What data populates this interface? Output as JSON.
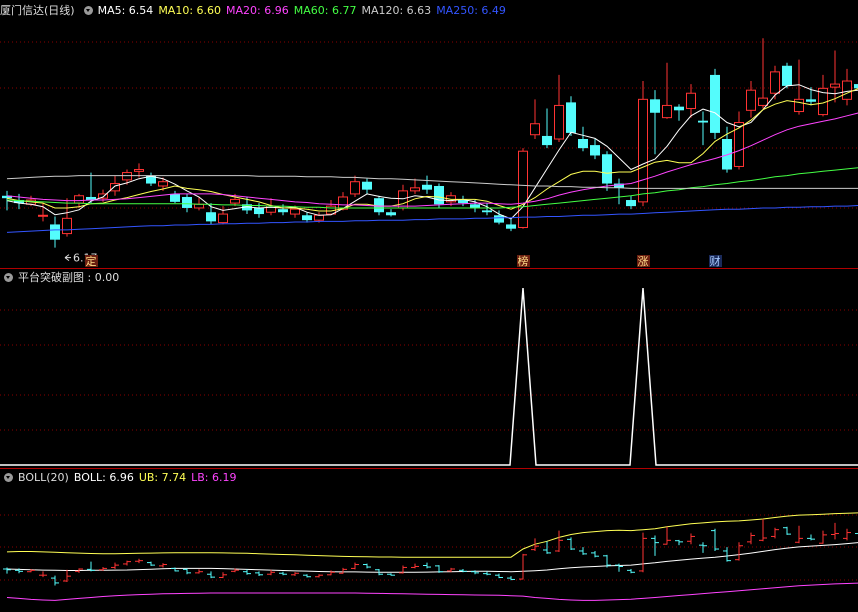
{
  "header1": {
    "stock": "厦门信达(日线)",
    "ma": [
      {
        "label": "MA5: 6.54",
        "color": "#ffffff"
      },
      {
        "label": "MA10: 6.60",
        "color": "#ffff55"
      },
      {
        "label": "MA20: 6.96",
        "color": "#ff44ff"
      },
      {
        "label": "MA60: 6.77",
        "color": "#44ff44"
      },
      {
        "label": "MA120: 6.63",
        "color": "#cccccc"
      },
      {
        "label": "MA250: 6.49",
        "color": "#3355ff"
      }
    ]
  },
  "header2": {
    "label": "平台突破副图 : 0.00"
  },
  "header3": {
    "name": "BOLL(20)",
    "items": [
      {
        "label": "BOLL: 6.96",
        "color": "#ffffff"
      },
      {
        "label": "UB: 7.74",
        "color": "#ffff55"
      },
      {
        "label": "LB: 6.19",
        "color": "#ff44ff"
      }
    ]
  },
  "annotations": {
    "low_label": "6.17"
  },
  "markers": [
    {
      "text": "定",
      "i": 7
    },
    {
      "text": "榜",
      "i": 43
    },
    {
      "text": "涨",
      "i": 53
    },
    {
      "text": "财",
      "i": 59
    }
  ],
  "colors": {
    "up": "#ff3333",
    "down": "#54fcfc",
    "grid": "#8a0000",
    "sep": "#b00000"
  },
  "chart_data": {
    "type": "candlestick",
    "bars": [
      [
        7.02,
        6.98,
        7.1,
        6.78
      ],
      [
        6.95,
        6.9,
        7.05,
        6.8
      ],
      [
        6.88,
        6.95,
        7.02,
        6.85
      ],
      [
        6.7,
        6.7,
        6.9,
        6.6
      ],
      [
        6.55,
        6.3,
        6.68,
        6.17
      ],
      [
        6.4,
        6.65,
        6.98,
        6.35
      ],
      [
        6.9,
        7.02,
        7.05,
        6.82
      ],
      [
        7.0,
        6.95,
        7.4,
        6.9
      ],
      [
        6.98,
        7.05,
        7.12,
        6.92
      ],
      [
        7.1,
        7.22,
        7.35,
        7.02
      ],
      [
        7.28,
        7.4,
        7.45,
        7.2
      ],
      [
        7.42,
        7.45,
        7.55,
        7.32
      ],
      [
        7.35,
        7.22,
        7.4,
        7.18
      ],
      [
        7.18,
        7.25,
        7.32,
        7.1
      ],
      [
        7.05,
        6.92,
        7.1,
        6.9
      ],
      [
        7.0,
        6.82,
        7.05,
        6.75
      ],
      [
        6.82,
        6.88,
        7.0,
        6.78
      ],
      [
        6.75,
        6.6,
        6.9,
        6.55
      ],
      [
        6.58,
        6.72,
        6.85,
        6.55
      ],
      [
        6.9,
        6.96,
        7.05,
        6.85
      ],
      [
        6.88,
        6.78,
        7.0,
        6.72
      ],
      [
        6.82,
        6.72,
        6.9,
        6.66
      ],
      [
        6.75,
        6.85,
        6.98,
        6.7
      ],
      [
        6.8,
        6.75,
        6.88,
        6.7
      ],
      [
        6.72,
        6.8,
        6.86,
        6.66
      ],
      [
        6.7,
        6.62,
        6.75,
        6.58
      ],
      [
        6.62,
        6.7,
        6.75,
        6.58
      ],
      [
        6.72,
        6.85,
        6.95,
        6.7
      ],
      [
        6.8,
        7.0,
        7.08,
        6.78
      ],
      [
        7.05,
        7.25,
        7.35,
        7.0
      ],
      [
        7.25,
        7.12,
        7.3,
        7.05
      ],
      [
        6.98,
        6.75,
        7.02,
        6.7
      ],
      [
        6.75,
        6.7,
        6.8,
        6.68
      ],
      [
        6.82,
        7.1,
        7.2,
        6.78
      ],
      [
        7.1,
        7.15,
        7.3,
        7.05
      ],
      [
        7.2,
        7.12,
        7.35,
        7.05
      ],
      [
        7.18,
        6.88,
        7.22,
        6.82
      ],
      [
        6.92,
        7.02,
        7.08,
        6.85
      ],
      [
        6.95,
        6.9,
        7.02,
        6.85
      ],
      [
        6.88,
        6.82,
        6.95,
        6.75
      ],
      [
        6.78,
        6.75,
        6.9,
        6.7
      ],
      [
        6.7,
        6.58,
        6.78,
        6.55
      ],
      [
        6.55,
        6.48,
        6.65,
        6.44
      ],
      [
        6.5,
        7.75,
        7.8,
        6.48
      ],
      [
        8.02,
        8.2,
        8.6,
        7.95
      ],
      [
        8.0,
        7.85,
        8.45,
        7.8
      ],
      [
        7.95,
        8.5,
        9.0,
        7.9
      ],
      [
        8.55,
        8.05,
        8.65,
        8.0
      ],
      [
        7.95,
        7.8,
        8.15,
        7.75
      ],
      [
        7.85,
        7.68,
        7.95,
        7.62
      ],
      [
        7.7,
        7.22,
        7.75,
        7.1
      ],
      [
        7.22,
        7.15,
        7.3,
        6.88
      ],
      [
        6.95,
        6.85,
        7.02,
        6.8
      ],
      [
        6.92,
        8.6,
        8.9,
        6.85
      ],
      [
        8.6,
        8.38,
        8.75,
        7.7
      ],
      [
        8.3,
        8.5,
        9.2,
        8.28
      ],
      [
        8.48,
        8.42,
        8.52,
        8.25
      ],
      [
        8.45,
        8.7,
        8.85,
        8.3
      ],
      [
        8.25,
        8.22,
        8.4,
        7.85
      ],
      [
        9.0,
        8.05,
        9.1,
        7.95
      ],
      [
        7.95,
        7.45,
        8.15,
        7.4
      ],
      [
        7.5,
        8.22,
        8.4,
        7.45
      ],
      [
        8.42,
        8.75,
        8.9,
        8.3
      ],
      [
        8.5,
        8.62,
        9.6,
        8.45
      ],
      [
        8.7,
        9.05,
        9.15,
        8.6
      ],
      [
        9.15,
        8.82,
        9.2,
        8.78
      ],
      [
        8.4,
        8.6,
        9.25,
        8.35
      ],
      [
        8.6,
        8.56,
        8.8,
        8.5
      ],
      [
        8.35,
        8.78,
        9.0,
        8.32
      ],
      [
        8.8,
        8.85,
        9.4,
        8.55
      ],
      [
        8.6,
        8.9,
        9.1,
        8.5
      ],
      [
        8.85,
        8.78,
        9.25,
        8.6
      ],
      [
        8.95,
        9.2,
        9.42,
        8.9
      ],
      [
        9.05,
        8.95,
        9.1,
        8.8
      ]
    ],
    "ma": [
      {
        "name": "MA5",
        "color": "#ffffff",
        "values": [
          6.94,
          6.9,
          6.88,
          6.84,
          6.71,
          6.74,
          6.79,
          6.93,
          7.0,
          7.18,
          7.23,
          7.3,
          7.34,
          7.3,
          7.21,
          7.1,
          7.0,
          6.84,
          6.78,
          6.81,
          6.84,
          6.82,
          6.83,
          6.82,
          6.83,
          6.75,
          6.7,
          6.71,
          6.81,
          6.93,
          7.05,
          7.01,
          6.98,
          6.97,
          7.02,
          7.0,
          6.95,
          6.94,
          6.96,
          6.92,
          6.84,
          6.72,
          6.64,
          6.84,
          7.15,
          7.46,
          7.77,
          8.06,
          8.01,
          7.96,
          7.83,
          7.64,
          7.45,
          7.54,
          7.62,
          7.83,
          8.1,
          8.33,
          8.44,
          8.38,
          8.22,
          8.15,
          8.22,
          8.43,
          8.67,
          8.82,
          8.84,
          8.76,
          8.71,
          8.69,
          8.73,
          8.75,
          8.89,
          8.96
        ]
      },
      {
        "name": "MA10",
        "color": "#ffff55",
        "values": [
          6.98,
          6.94,
          6.92,
          6.9,
          6.82,
          6.82,
          6.84,
          6.89,
          6.9,
          6.95,
          6.99,
          7.04,
          7.09,
          7.13,
          7.18,
          7.14,
          7.12,
          7.09,
          7.04,
          7.0,
          6.96,
          6.92,
          6.86,
          6.82,
          6.82,
          6.8,
          6.77,
          6.77,
          6.81,
          6.88,
          6.88,
          6.85,
          6.85,
          6.89,
          6.97,
          7.01,
          7.0,
          6.96,
          6.96,
          6.96,
          6.93,
          6.86,
          6.8,
          6.88,
          6.99,
          7.13,
          7.25,
          7.37,
          7.42,
          7.42,
          7.39,
          7.41,
          7.41,
          7.49,
          7.57,
          7.6,
          7.56,
          7.56,
          7.71,
          7.91,
          8.03,
          8.13,
          8.26,
          8.43,
          8.52,
          8.58,
          8.55,
          8.51,
          8.54,
          8.61,
          8.7,
          8.78,
          8.87,
          8.92
        ]
      },
      {
        "name": "MA20",
        "color": "#ff44ff",
        "values": [
          7.02,
          7.0,
          6.98,
          6.96,
          6.95,
          6.94,
          6.94,
          6.95,
          6.95,
          6.96,
          6.97,
          6.99,
          7.01,
          7.03,
          7.05,
          7.05,
          7.05,
          7.05,
          7.04,
          7.02,
          7.0,
          6.98,
          6.96,
          6.94,
          6.92,
          6.91,
          6.89,
          6.88,
          6.87,
          6.87,
          6.86,
          6.85,
          6.85,
          6.85,
          6.85,
          6.86,
          6.87,
          6.88,
          6.89,
          6.9,
          6.9,
          6.89,
          6.88,
          6.9,
          6.93,
          6.97,
          7.03,
          7.08,
          7.12,
          7.15,
          7.18,
          7.2,
          7.22,
          7.28,
          7.34,
          7.41,
          7.47,
          7.53,
          7.58,
          7.63,
          7.69,
          7.76,
          7.84,
          7.93,
          8.02,
          8.1,
          8.16,
          8.2,
          8.24,
          8.28,
          8.33,
          8.38,
          8.43,
          8.48
        ]
      },
      {
        "name": "MA60",
        "color": "#44ff44",
        "values": [
          6.95,
          6.94,
          6.93,
          6.92,
          6.91,
          6.9,
          6.9,
          6.89,
          6.89,
          6.89,
          6.89,
          6.89,
          6.89,
          6.89,
          6.89,
          6.89,
          6.88,
          6.88,
          6.87,
          6.87,
          6.86,
          6.86,
          6.85,
          6.85,
          6.84,
          6.83,
          6.83,
          6.82,
          6.82,
          6.82,
          6.82,
          6.82,
          6.82,
          6.82,
          6.82,
          6.82,
          6.82,
          6.82,
          6.82,
          6.82,
          6.82,
          6.82,
          6.83,
          6.84,
          6.86,
          6.88,
          6.9,
          6.92,
          6.94,
          6.96,
          6.98,
          7.0,
          7.02,
          7.05,
          7.07,
          7.1,
          7.12,
          7.15,
          7.17,
          7.2,
          7.22,
          7.25,
          7.27,
          7.3,
          7.33,
          7.35,
          7.38,
          7.4,
          7.42,
          7.44,
          7.46,
          7.48,
          7.5,
          7.52
        ]
      },
      {
        "name": "MA120",
        "color": "#cccccc",
        "values": [
          7.3,
          7.31,
          7.32,
          7.33,
          7.34,
          7.34,
          7.35,
          7.35,
          7.35,
          7.35,
          7.35,
          7.35,
          7.35,
          7.35,
          7.35,
          7.35,
          7.35,
          7.35,
          7.35,
          7.35,
          7.35,
          7.34,
          7.34,
          7.34,
          7.34,
          7.33,
          7.33,
          7.33,
          7.32,
          7.32,
          7.31,
          7.3,
          7.3,
          7.29,
          7.28,
          7.27,
          7.26,
          7.25,
          7.24,
          7.23,
          7.22,
          7.21,
          7.2,
          7.19,
          7.18,
          7.18,
          7.17,
          7.17,
          7.16,
          7.16,
          7.15,
          7.15,
          7.14,
          7.14,
          7.14,
          7.14,
          7.14,
          7.14,
          7.14,
          7.14,
          7.14,
          7.14,
          7.14,
          7.14,
          7.14,
          7.14,
          7.14,
          7.14,
          7.14,
          7.14,
          7.14,
          7.14,
          7.14,
          7.14
        ]
      },
      {
        "name": "MA250",
        "color": "#3355ff",
        "values": [
          6.42,
          6.43,
          6.44,
          6.45,
          6.46,
          6.46,
          6.47,
          6.48,
          6.49,
          6.5,
          6.51,
          6.52,
          6.53,
          6.53,
          6.54,
          6.54,
          6.55,
          6.55,
          6.56,
          6.56,
          6.57,
          6.57,
          6.58,
          6.58,
          6.59,
          6.59,
          6.6,
          6.6,
          6.6,
          6.61,
          6.61,
          6.62,
          6.62,
          6.62,
          6.63,
          6.63,
          6.64,
          6.64,
          6.64,
          6.65,
          6.65,
          6.66,
          6.66,
          6.67,
          6.67,
          6.68,
          6.68,
          6.69,
          6.7,
          6.7,
          6.71,
          6.72,
          6.72,
          6.73,
          6.74,
          6.75,
          6.76,
          6.77,
          6.78,
          6.79,
          6.8,
          6.8,
          6.81,
          6.82,
          6.82,
          6.83,
          6.83,
          6.84,
          6.84,
          6.85,
          6.85,
          6.86,
          6.86,
          6.87
        ]
      }
    ],
    "price_range": [
      6.0,
      9.9
    ],
    "signal": {
      "values_nonzero_at": [
        43,
        53
      ]
    },
    "boll_range": [
      4.8,
      11.2
    ],
    "boll": [
      {
        "name": "UB",
        "color": "#ffff55",
        "values": [
          7.9,
          7.92,
          7.92,
          7.9,
          7.88,
          7.86,
          7.84,
          7.82,
          7.81,
          7.81,
          7.82,
          7.83,
          7.84,
          7.85,
          7.86,
          7.86,
          7.86,
          7.86,
          7.85,
          7.84,
          7.83,
          7.81,
          7.79,
          7.77,
          7.75,
          7.73,
          7.71,
          7.69,
          7.67,
          7.66,
          7.65,
          7.64,
          7.64,
          7.63,
          7.63,
          7.63,
          7.63,
          7.63,
          7.63,
          7.63,
          7.63,
          7.63,
          7.63,
          8.05,
          8.3,
          8.45,
          8.65,
          8.8,
          8.9,
          8.95,
          9.0,
          9.02,
          9.0,
          9.05,
          9.1,
          9.2,
          9.28,
          9.35,
          9.4,
          9.45,
          9.48,
          9.5,
          9.55,
          9.6,
          9.68,
          9.75,
          9.8,
          9.82,
          9.85,
          9.88,
          9.9,
          9.92,
          9.95,
          9.96
        ]
      },
      {
        "name": "BOLL",
        "color": "#ffffff",
        "values": [
          7.02,
          7.0,
          6.98,
          6.96,
          6.95,
          6.94,
          6.94,
          6.95,
          6.95,
          6.96,
          6.97,
          6.99,
          7.01,
          7.03,
          7.05,
          7.05,
          7.05,
          7.05,
          7.04,
          7.02,
          7.0,
          6.98,
          6.96,
          6.94,
          6.92,
          6.91,
          6.89,
          6.88,
          6.87,
          6.87,
          6.86,
          6.85,
          6.85,
          6.85,
          6.85,
          6.86,
          6.87,
          6.88,
          6.89,
          6.9,
          6.9,
          6.89,
          6.88,
          6.9,
          6.93,
          6.97,
          7.03,
          7.08,
          7.12,
          7.15,
          7.18,
          7.2,
          7.22,
          7.28,
          7.34,
          7.41,
          7.47,
          7.53,
          7.58,
          7.63,
          7.69,
          7.76,
          7.84,
          7.93,
          8.02,
          8.1,
          8.16,
          8.2,
          8.24,
          8.28,
          8.33,
          8.38,
          8.43,
          8.48
        ]
      },
      {
        "name": "LB",
        "color": "#ff44ff",
        "values": [
          5.55,
          5.5,
          5.45,
          5.42,
          5.4,
          5.45,
          5.5,
          5.55,
          5.6,
          5.64,
          5.67,
          5.7,
          5.72,
          5.74,
          5.75,
          5.76,
          5.77,
          5.78,
          5.78,
          5.78,
          5.78,
          5.78,
          5.78,
          5.78,
          5.78,
          5.78,
          5.78,
          5.78,
          5.78,
          5.78,
          5.77,
          5.76,
          5.75,
          5.74,
          5.73,
          5.72,
          5.71,
          5.7,
          5.69,
          5.68,
          5.67,
          5.66,
          5.64,
          5.62,
          5.55,
          5.5,
          5.45,
          5.42,
          5.4,
          5.4,
          5.42,
          5.44,
          5.46,
          5.5,
          5.55,
          5.6,
          5.65,
          5.7,
          5.75,
          5.8,
          5.85,
          5.9,
          5.95,
          6.0,
          6.05,
          6.1,
          6.15,
          6.19,
          6.22,
          6.25,
          6.27,
          6.29,
          6.3,
          6.31
        ]
      }
    ]
  }
}
